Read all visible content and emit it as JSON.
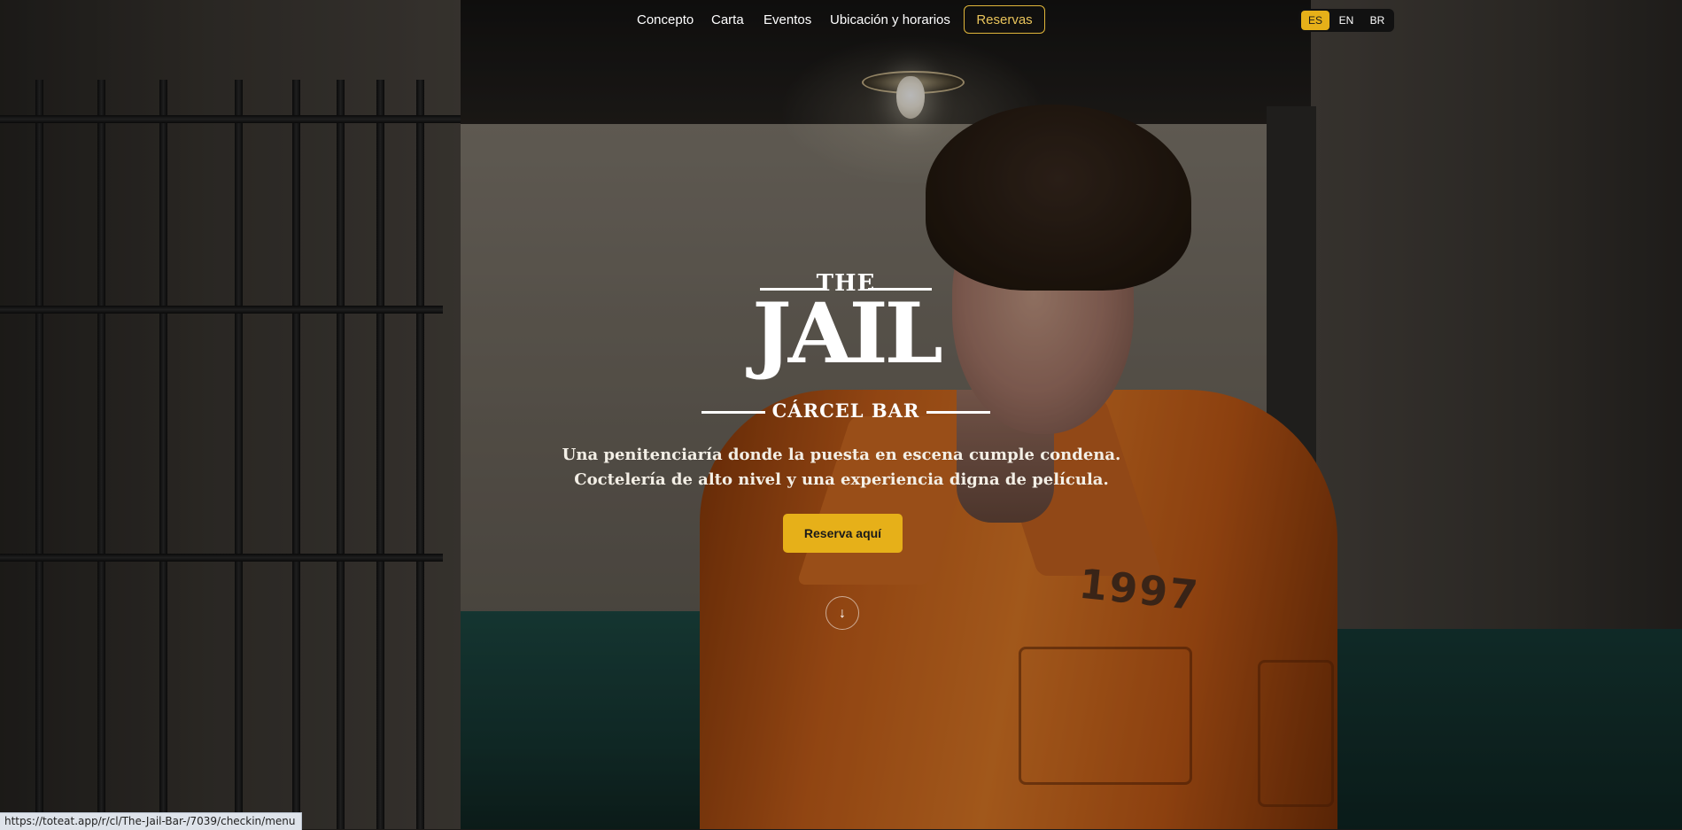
{
  "nav": {
    "links": [
      "Concepto",
      "Carta",
      "Eventos",
      "Ubicación y horarios"
    ],
    "reservas_label": "Reservas",
    "languages": [
      "ES",
      "EN",
      "BR"
    ],
    "active_language": "ES"
  },
  "logo": {
    "the": "THE",
    "jail": "JAIL",
    "subtitle": "CÁRCEL BAR"
  },
  "hero": {
    "tagline_line1": "Una penitenciaría donde la puesta en escena cumple condena.",
    "tagline_line2": "Coctelería de alto nivel y una experiencia digna de película.",
    "cta_label": "Reserva aquí",
    "scroll_icon": "arrow-down-icon",
    "scroll_glyph": "↓",
    "jumpsuit_number": "1997"
  },
  "status_bar": {
    "url": "https://toteat.app/r/cl/The-Jail-Bar-/7039/checkin/menu"
  },
  "colors": {
    "accent": "#e6b019",
    "reservas_border": "#e0b53a",
    "jumpsuit": "#e07a26"
  }
}
